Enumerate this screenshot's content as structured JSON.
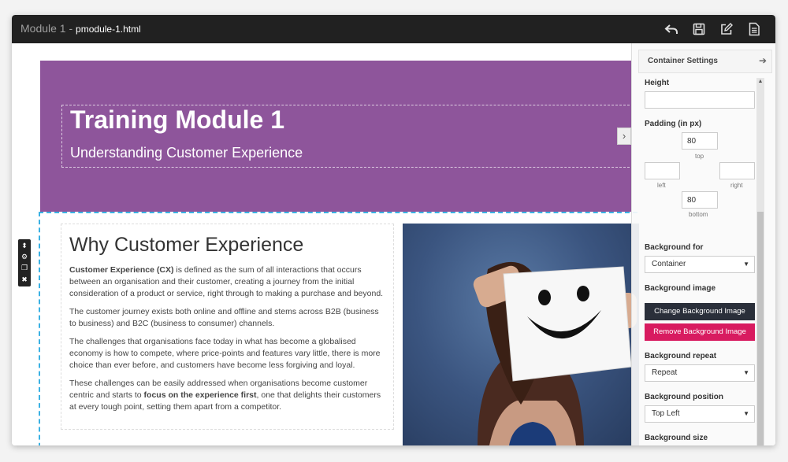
{
  "window": {
    "title": "Module 1",
    "separator": " - ",
    "filename": "pmodule-1.html",
    "icons": [
      "undo-icon",
      "save-icon",
      "edit-icon",
      "document-icon"
    ]
  },
  "hero": {
    "title": "Training Module 1",
    "subtitle": "Understanding Customer Experience",
    "bg_color": "#8e559b"
  },
  "section": {
    "title": "Why Customer Experience",
    "p1_bold": "Customer Experience (CX)",
    "p1_rest": " is defined as the sum of all interactions that occurs between an organisation and their customer, creating a journey from the initial consideration of a product or service, right through to making a purchase and beyond.",
    "p2": "The customer journey exists both online and offline and stems across B2B (business to business) and B2C (business to consumer) channels.",
    "p3": "The challenges that organisations face today in what has become a globalised economy is how to compete, where price-points and features vary little, there is more choice than ever before, and customers have become less forgiving and loyal.",
    "p4_start": "These challenges can be easily addressed when organisations become customer centric and starts to ",
    "p4_bold": "focus on the experience first",
    "p4_end": ", one that delights their customers at every tough point, setting them apart from a competitor."
  },
  "panel": {
    "title": "Container Settings",
    "height_label": "Height",
    "height_value": "",
    "padding_label": "Padding (in px)",
    "padding_top": "80",
    "padding_bottom": "80",
    "padding_left": "",
    "padding_right": "",
    "top_caption": "top",
    "left_caption": "left",
    "right_caption": "right",
    "bottom_caption": "bottom",
    "bg_for_label": "Background for",
    "bg_for_value": "Container",
    "bg_image_label": "Background image",
    "change_bg_button": "Change Background Image",
    "remove_bg_button": "Remove Background Image",
    "bg_repeat_label": "Background repeat",
    "bg_repeat_value": "Repeat",
    "bg_position_label": "Background position",
    "bg_position_value": "Top Left",
    "bg_size_label": "Background size",
    "change_btn_color": "#2a2f3a",
    "remove_btn_color": "#d81b60"
  },
  "accent": {
    "selection_border": "#3bb1e3",
    "topbar": "#212121"
  }
}
